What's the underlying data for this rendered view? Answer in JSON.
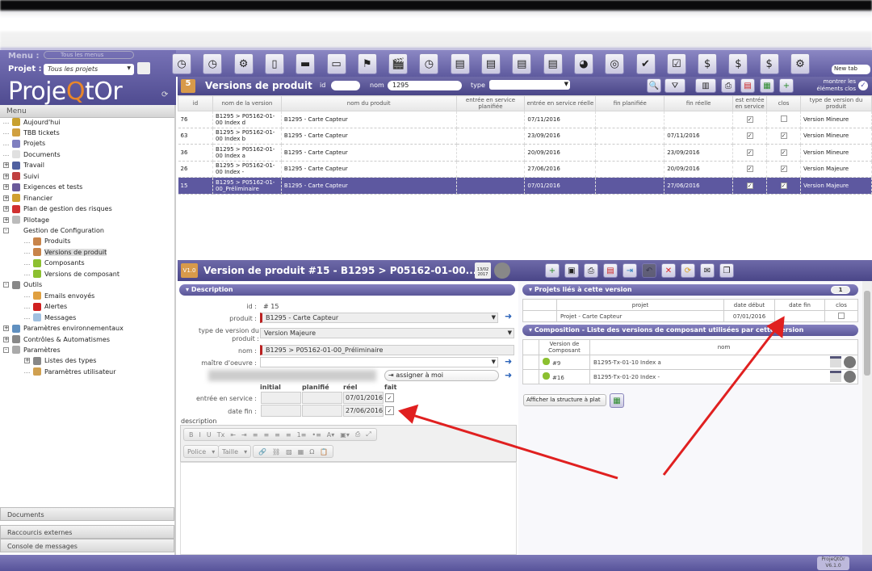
{
  "header": {
    "menu_label": "Menu :",
    "menu_value": "Tous les menus",
    "project_label": "Projet :",
    "project_value": "Tous les projets",
    "logo_text": "ProjeQtOr",
    "new_tab": "New tab"
  },
  "toolbar_icons": [
    "today",
    "tickets",
    "projects",
    "documents",
    "ticket",
    "work",
    "risk",
    "meeting",
    "planning",
    "gantt",
    "projects-portfolio",
    "resource-plan",
    "activity-plan",
    "reports",
    "requirements",
    "checklist",
    "tasks",
    "costs",
    "financial",
    "budget",
    "settings"
  ],
  "menu": {
    "title": "Menu",
    "items": [
      {
        "label": "Aujourd'hui",
        "level": 0,
        "expander": "",
        "icon": "clock-icon",
        "color": "#c8a030"
      },
      {
        "label": "TBB tickets",
        "level": 0,
        "expander": "",
        "icon": "ticket-icon",
        "color": "#d0a040"
      },
      {
        "label": "Projets",
        "level": 0,
        "expander": "",
        "icon": "gear-icon",
        "color": "#8080c0"
      },
      {
        "label": "Documents",
        "level": 0,
        "expander": "",
        "icon": "document-icon",
        "color": "#e0e0e0"
      },
      {
        "label": "Travail",
        "level": 0,
        "expander": "+",
        "icon": "computer-icon",
        "color": "#5060a0"
      },
      {
        "label": "Suivi",
        "level": 0,
        "expander": "+",
        "icon": "chart-icon",
        "color": "#c04040"
      },
      {
        "label": "Exigences et tests",
        "level": 0,
        "expander": "+",
        "icon": "target-icon",
        "color": "#6a5a9a"
      },
      {
        "label": "Financier",
        "level": 0,
        "expander": "+",
        "icon": "money-bag-icon",
        "color": "#d0a030"
      },
      {
        "label": "Plan de gestion des risques",
        "level": 0,
        "expander": "+",
        "icon": "warning-icon",
        "color": "#d03030"
      },
      {
        "label": "Pilotage",
        "level": 0,
        "expander": "+",
        "icon": "steering-icon",
        "color": "#bbb"
      },
      {
        "label": "Gestion de Configuration",
        "level": 0,
        "expander": "-",
        "icon": "",
        "color": ""
      },
      {
        "label": "Produits",
        "level": 1,
        "expander": "",
        "icon": "box-icon",
        "color": "#c8844a"
      },
      {
        "label": "Versions de produit",
        "level": 1,
        "expander": "",
        "icon": "version-icon",
        "color": "#c8844a",
        "selected": true
      },
      {
        "label": "Composants",
        "level": 1,
        "expander": "",
        "icon": "component-icon",
        "color": "#8cc030"
      },
      {
        "label": "Versions de composant",
        "level": 1,
        "expander": "",
        "icon": "component-version-icon",
        "color": "#8cc030"
      },
      {
        "label": "Outils",
        "level": 0,
        "expander": "-",
        "icon": "tools-icon",
        "color": "#888"
      },
      {
        "label": "Emails envoyés",
        "level": 1,
        "expander": "",
        "icon": "email-icon",
        "color": "#e0a040"
      },
      {
        "label": "Alertes",
        "level": 1,
        "expander": "",
        "icon": "alert-icon",
        "color": "#d02020"
      },
      {
        "label": "Messages",
        "level": 1,
        "expander": "",
        "icon": "message-icon",
        "color": "#a0c0e0"
      },
      {
        "label": "Paramètres environnementaux",
        "level": 0,
        "expander": "+",
        "icon": "globe-icon",
        "color": "#6090c0"
      },
      {
        "label": "Contrôles & Automatismes",
        "level": 0,
        "expander": "+",
        "icon": "automation-icon",
        "color": "#888"
      },
      {
        "label": "Paramètres",
        "level": 0,
        "expander": "-",
        "icon": "wrench-icon",
        "color": "#aaa"
      },
      {
        "label": "Listes des types",
        "level": 1,
        "expander": "+",
        "icon": "list-icon",
        "color": "#888"
      },
      {
        "label": "Paramètres utilisateur",
        "level": 1,
        "expander": "",
        "icon": "user-settings-icon",
        "color": "#d0a050"
      }
    ]
  },
  "accordions": [
    "Documents",
    "Raccourcis externes",
    "Console de messages"
  ],
  "list": {
    "title": "Versions de produit",
    "id_label": "id",
    "id_value": "",
    "name_label": "nom",
    "name_value": "1295",
    "type_label": "type",
    "type_value": "",
    "show_closed": "montrer les éléments clos",
    "columns": [
      "id",
      "nom de la version",
      "nom du produit",
      "entrée en service planifiée",
      "entrée en service réelle",
      "fin planifiée",
      "fin réelle",
      "est entrée en service",
      "clos",
      "type de version du produit"
    ],
    "rows": [
      {
        "id": "76",
        "version": "B1295 > P05162-01-00 Index d",
        "product": "B1295 - Carte Capteur",
        "planned_start": "",
        "real_start": "07/11/2016",
        "planned_end": "",
        "real_end": "",
        "in_service": true,
        "closed": false,
        "type": "Version Mineure"
      },
      {
        "id": "63",
        "version": "B1295 > P05162-01-00 Index b",
        "product": "B1295 - Carte Capteur",
        "planned_start": "",
        "real_start": "23/09/2016",
        "planned_end": "",
        "real_end": "07/11/2016",
        "in_service": true,
        "closed": true,
        "type": "Version Mineure"
      },
      {
        "id": "36",
        "version": "B1295 > P05162-01-00 Index a",
        "product": "B1295 - Carte Capteur",
        "planned_start": "",
        "real_start": "20/09/2016",
        "planned_end": "",
        "real_end": "23/09/2016",
        "in_service": true,
        "closed": true,
        "type": "Version Mineure"
      },
      {
        "id": "26",
        "version": "B1295 > P05162-01-00 Index -",
        "product": "B1295 - Carte Capteur",
        "planned_start": "",
        "real_start": "27/06/2016",
        "planned_end": "",
        "real_end": "20/09/2016",
        "in_service": true,
        "closed": true,
        "type": "Version Majeure"
      },
      {
        "id": "15",
        "version": "B1295 > P05162-01-00_Préliminaire",
        "product": "B1295 - Carte Capteur",
        "planned_start": "",
        "real_start": "07/01/2016",
        "planned_end": "",
        "real_end": "27/06/2016",
        "in_service": true,
        "closed": true,
        "type": "Version Majeure",
        "selected": true
      }
    ]
  },
  "detail": {
    "title": "Version de produit #15 - B1295 > P05162-01-00...",
    "version_badge": "V1.0",
    "calendar_date": "13/02 2017",
    "description_section": "Description",
    "id_label": "id :",
    "id_value": "#  15",
    "product_label": "produit :",
    "product_value": "B1295 - Carte Capteur",
    "type_label": "type de version du produit :",
    "type_value": "Version Majeure",
    "name_label": "nom :",
    "name_value": "B1295 >  P05162-01-00_Préliminaire",
    "owner_label": "maître d'oeuvre :",
    "owner_value": "",
    "assign_me": "assigner à moi",
    "col_initial": "initial",
    "col_planned": "planifié",
    "col_real": "réel",
    "col_done": "fait",
    "service_label": "entrée en service :",
    "service_real": "07/01/2016",
    "service_done": true,
    "end_label": "date fin :",
    "end_real": "27/06/2016",
    "end_done": true,
    "description_label": "description",
    "editor_row1": [
      "B",
      "I",
      "U",
      "Tx",
      "⇤",
      "⇥",
      "≡",
      "≡",
      "≡",
      "≡",
      "1≡",
      "•≡",
      "A▾",
      "▣▾",
      "⎙",
      "⤢"
    ],
    "font_label": "Police",
    "size_label": "Taille",
    "editor_row2": [
      "🔗",
      "⛓",
      "▨",
      "▦",
      "Ω",
      "📋"
    ]
  },
  "projects_section": {
    "title": "Projets liés à cette version",
    "count": "1",
    "columns": [
      "projet",
      "date début",
      "date fin",
      "clos"
    ],
    "rows": [
      {
        "project": "Projet - Carte Capteur",
        "start": "07/01/2016",
        "end": "",
        "closed": false
      }
    ]
  },
  "composition_section": {
    "title": "Composition - Liste des versions de composant utilisées par cette version",
    "columns": [
      "Version de Composant",
      "nom"
    ],
    "rows": [
      {
        "ref": "#9",
        "name": "B1295-Tx-01-10 Index a"
      },
      {
        "ref": "#16",
        "name": "B1295-Tx-01-20 Index -"
      }
    ],
    "flat_button": "Afficher la structure à plat"
  },
  "footer": {
    "version": "ProjeQtOr V6.1.0"
  },
  "colors": {
    "header": "#5e5a9e",
    "selected_row": "#5d58a0",
    "annotation_arrow": "#e02020"
  }
}
